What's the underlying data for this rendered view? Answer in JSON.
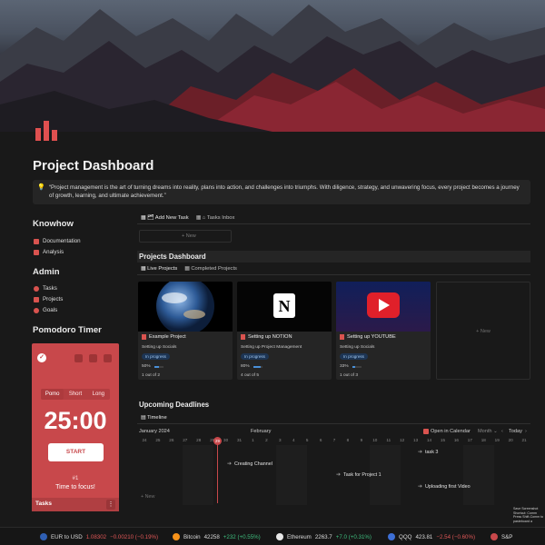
{
  "page": {
    "title": "Project Dashboard",
    "quote": "“Project management is the art of turning dreams into reality, plans into action, and challenges into triumphs. With diligence, strategy, and unwavering focus, every project becomes a journey of growth, learning, and ultimate achievement.”",
    "accent": "#c8484b"
  },
  "knowhow": {
    "heading": "Knowhow",
    "items": [
      {
        "label": "Documentation",
        "icon": "book-icon"
      },
      {
        "label": "Analysis",
        "icon": "book-icon"
      }
    ]
  },
  "admin": {
    "heading": "Admin",
    "items": [
      {
        "label": "Tasks",
        "icon": "check-circle-icon"
      },
      {
        "label": "Projects",
        "icon": "folder-icon"
      },
      {
        "label": "Goals",
        "icon": "target-icon"
      }
    ]
  },
  "pomodoro": {
    "heading": "Pomodoro Timer",
    "tabs": [
      "Pomo",
      "Short",
      "Long"
    ],
    "time": "25:00",
    "start_label": "START",
    "session": "#1",
    "message": "Time to focus!",
    "footer_label": "Tasks",
    "menu_glyph": "⋮"
  },
  "tasks_tabs": {
    "add": "Add New Task",
    "inbox": "Tasks Inbox",
    "new_label": "+ New"
  },
  "projects": {
    "heading": "Projects Dashboard",
    "tabs": [
      "Live Projects",
      "Completed Projects"
    ],
    "new_label": "+ New",
    "cards": [
      {
        "title": "Example Project",
        "subtitle": "Setting up Socials",
        "status": "In progress",
        "percent": "50%",
        "progress": 0.5,
        "count": "1 out of 2"
      },
      {
        "title": "Setting up NOTION",
        "subtitle": "Setting up Project Management",
        "status": "In progress",
        "percent": "80%",
        "progress": 0.8,
        "count": "4 out of 5"
      },
      {
        "title": "Setting up YOUTUBE",
        "subtitle": "Setting up Socials",
        "status": "In progress",
        "percent": "33%",
        "progress": 0.33,
        "count": "1 out of 3"
      }
    ]
  },
  "deadlines": {
    "heading": "Upcoming Deadlines",
    "view_tab": "Timeline",
    "month1": "January 2024",
    "month2": "February",
    "open_calendar": "Open in Calendar",
    "range": "Month ⌄",
    "today": "Today",
    "days": [
      "24",
      "25",
      "26",
      "27",
      "28",
      "29",
      "30",
      "31",
      "1",
      "2",
      "3",
      "4",
      "5",
      "6",
      "7",
      "8",
      "9",
      "10",
      "11",
      "12",
      "13",
      "14",
      "15",
      "16",
      "17",
      "18",
      "19",
      "20",
      "21"
    ],
    "today_day": "29",
    "tasks": [
      {
        "label": "task 3"
      },
      {
        "label": "Creating Channel"
      },
      {
        "label": "Task for Project 1"
      },
      {
        "label": "Uploading first Video"
      }
    ],
    "new_label": "+ New"
  },
  "ticker": [
    {
      "name": "EUR to USD",
      "price": "1.08302",
      "change": "−0.00210 (−0.19%)",
      "dir": "dn",
      "color": "#2f5fb3"
    },
    {
      "name": "Bitcoin",
      "price": "42258",
      "change": "+232 (+0.55%)",
      "dir": "up",
      "color": "#f7931a"
    },
    {
      "name": "Ethereum",
      "price": "2263.7",
      "change": "+7.0 (+0.31%)",
      "dir": "up",
      "color": "#e8e8e8"
    },
    {
      "name": "QQQ",
      "price": "423.81",
      "change": "−2.54 (−0.60%)",
      "dir": "dn",
      "color": "#3d6fd6"
    },
    {
      "name": "S&P",
      "price": "",
      "change": "",
      "dir": "dn",
      "color": "#c8484b"
    }
  ],
  "tooltip": "Save Screenshot Shortcut: Comm Press Shift-Comm to pasteboard a"
}
